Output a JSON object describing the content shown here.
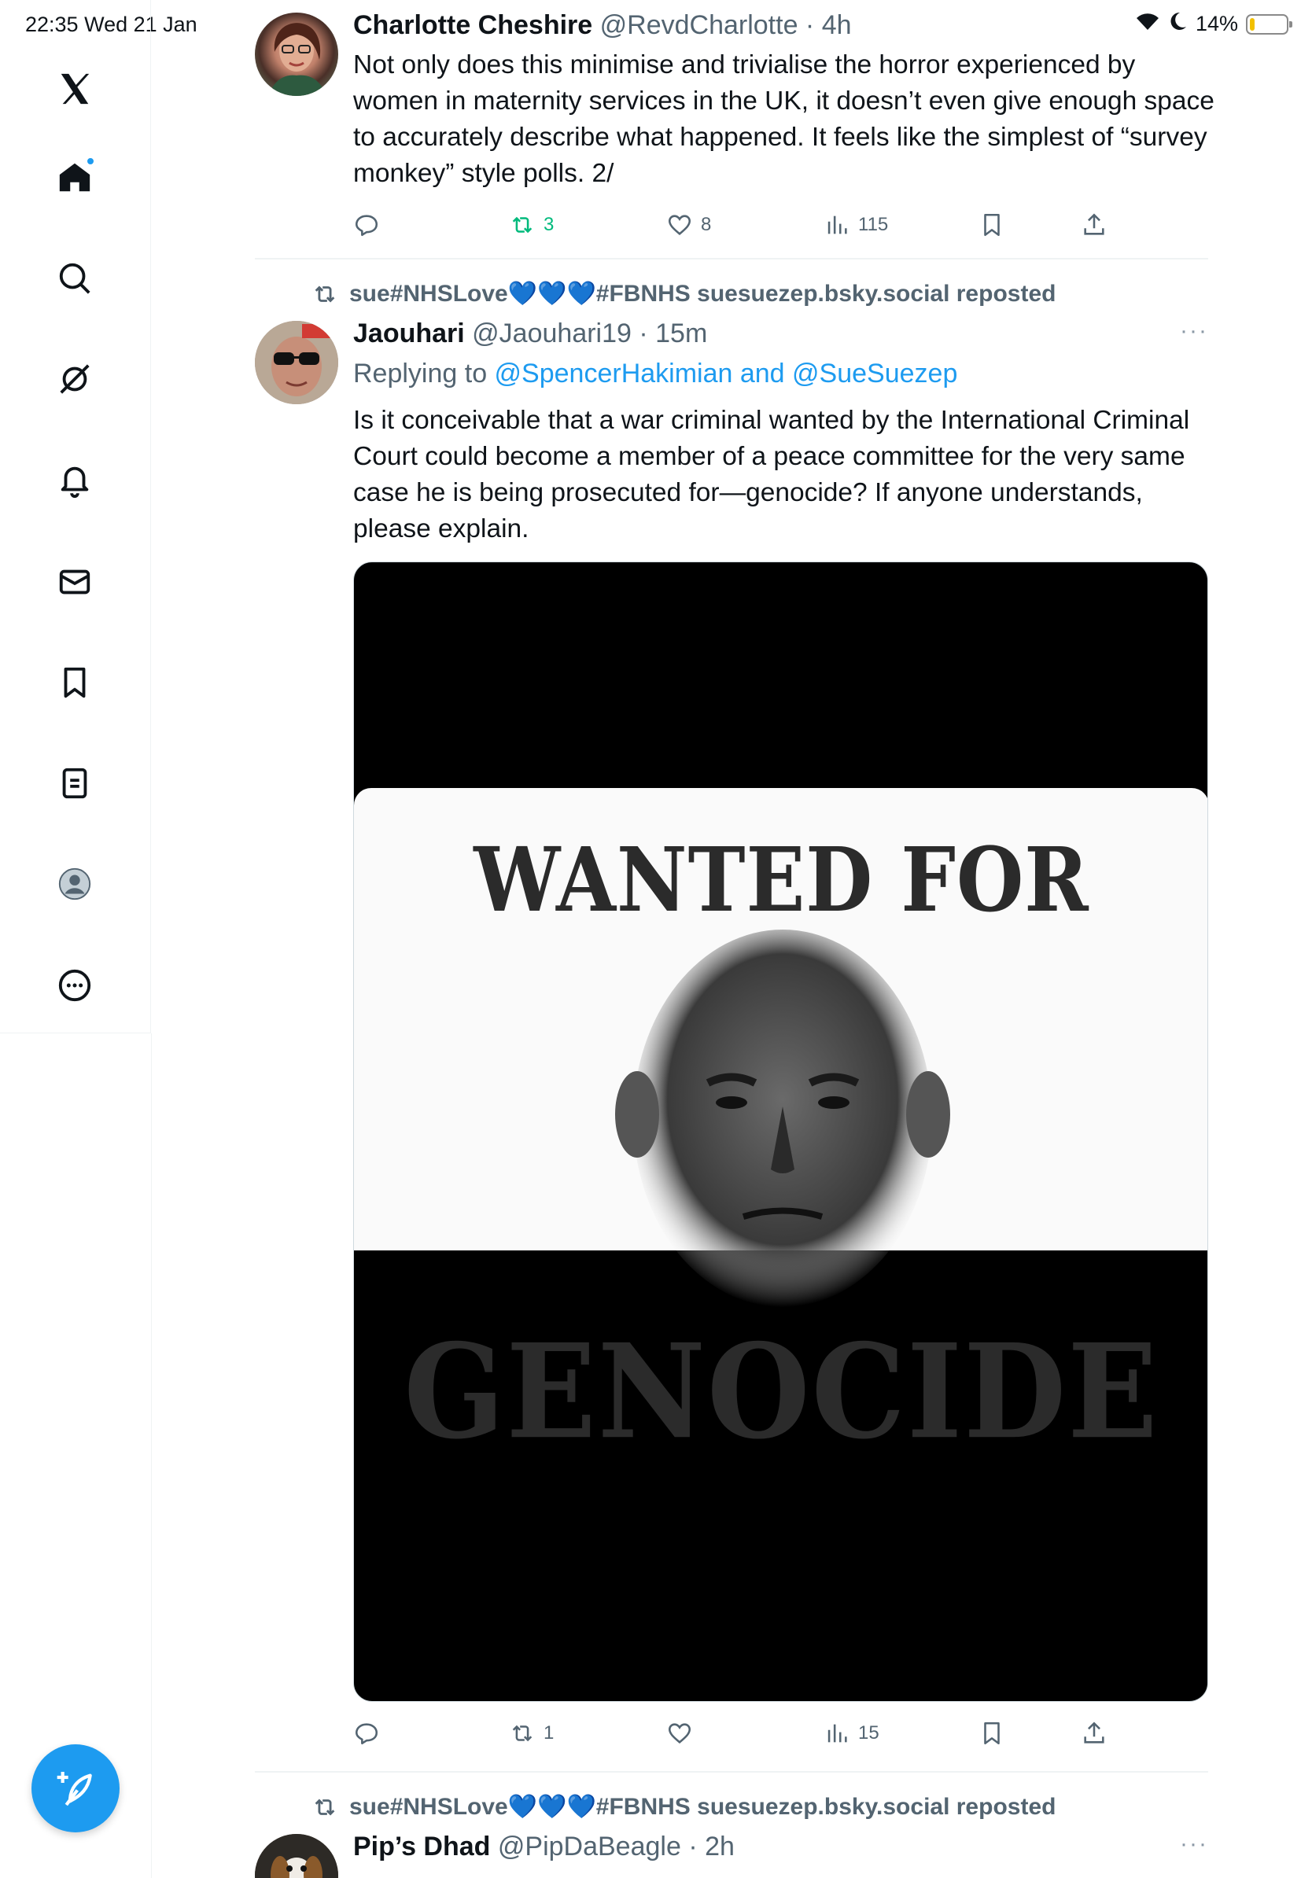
{
  "status_bar": {
    "time_date": "22:35   Wed 21 Jan",
    "battery_text": "14%",
    "battery_level": 0.14
  },
  "sidebar": {
    "items": [
      {
        "icon": "x-logo-icon"
      },
      {
        "icon": "home-icon",
        "notification_dot": true
      },
      {
        "icon": "search-icon"
      },
      {
        "icon": "grok-icon"
      },
      {
        "icon": "bell-icon"
      },
      {
        "icon": "mail-icon"
      },
      {
        "icon": "bookmark-icon"
      },
      {
        "icon": "lists-icon"
      },
      {
        "icon": "profile-icon"
      },
      {
        "icon": "more-circle-icon"
      }
    ],
    "compose_icon": "compose-feather-icon",
    "accent_color": "#1d9bf0"
  },
  "tweets": [
    {
      "display_name": "Charlotte Cheshire",
      "handle_time": "@RevdCharlotte · 4h",
      "text": "Not only does this minimise and trivialise the horror experienced by women in maternity services in the UK, it doesn’t even give enough space to accurately describe what happened. It feels like the simplest of “survey monkey” style polls. 2/",
      "reply_count": "",
      "repost_count": "3",
      "like_count": "8",
      "view_count": "115"
    },
    {
      "repost_label": "sue#NHSLove💙💙💙#FBNHS suesuezep.bsky.social reposted",
      "display_name": "Jaouhari",
      "handle_time": "@Jaouhari19 · 15m",
      "reply_prefix": "Replying to ",
      "reply_targets": "@SpencerHakimian and @SueSuezep",
      "text": "Is it conceivable that a war criminal wanted by the International Criminal Court could become a member of a peace committee for the very same case he is being prosecuted for—genocide? If anyone understands, please explain.",
      "media": {
        "top_text": "WANTED FOR",
        "bottom_text": "GENOCIDE"
      },
      "reply_count": "",
      "repost_count": "1",
      "like_count": "",
      "view_count": "15"
    },
    {
      "repost_label": "sue#NHSLove💙💙💙#FBNHS suesuezep.bsky.social reposted",
      "display_name": "Pip’s Dhad",
      "handle_time": "@PipDaBeagle · 2h"
    }
  ],
  "more_label": "···"
}
